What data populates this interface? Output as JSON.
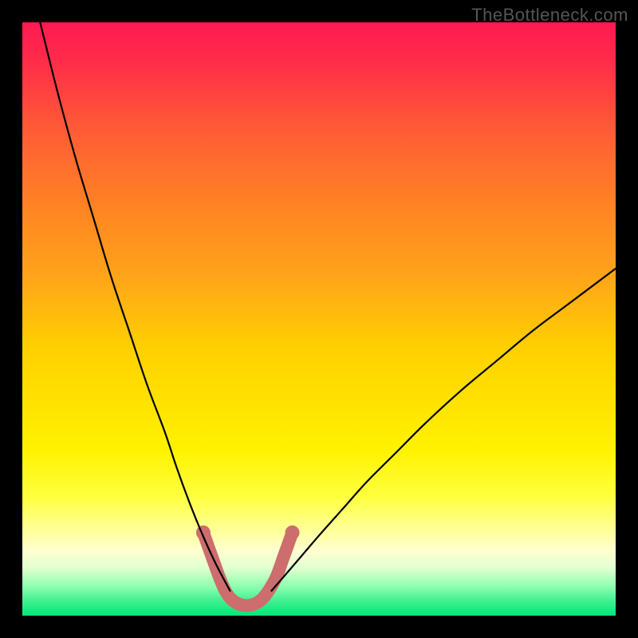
{
  "attribution": "TheBottleneck.com",
  "chart_data": {
    "type": "line",
    "title": "",
    "xlabel": "",
    "ylabel": "",
    "xlim": [
      0,
      100
    ],
    "ylim": [
      0,
      100
    ],
    "background_gradient": {
      "stops": [
        {
          "offset": 0.0,
          "color": "#ff1a52"
        },
        {
          "offset": 0.06,
          "color": "#ff2a4a"
        },
        {
          "offset": 0.18,
          "color": "#ff5b36"
        },
        {
          "offset": 0.3,
          "color": "#ff8024"
        },
        {
          "offset": 0.42,
          "color": "#ffa21a"
        },
        {
          "offset": 0.55,
          "color": "#ffd000"
        },
        {
          "offset": 0.72,
          "color": "#fff200"
        },
        {
          "offset": 0.8,
          "color": "#ffff40"
        },
        {
          "offset": 0.85,
          "color": "#ffff90"
        },
        {
          "offset": 0.89,
          "color": "#ffffd0"
        },
        {
          "offset": 0.92,
          "color": "#e0ffd0"
        },
        {
          "offset": 0.95,
          "color": "#90ffb0"
        },
        {
          "offset": 0.975,
          "color": "#40f090"
        },
        {
          "offset": 1.0,
          "color": "#00e878"
        }
      ]
    },
    "series": [
      {
        "name": "left-curve",
        "x": [
          3,
          6,
          9,
          12,
          15,
          18,
          21,
          24,
          26,
          28,
          30,
          32,
          33.5,
          35
        ],
        "y": [
          100,
          88,
          77,
          67,
          57,
          48,
          39,
          31,
          25,
          19.5,
          14.5,
          10,
          7,
          4.2
        ]
      },
      {
        "name": "right-curve",
        "x": [
          42,
          44,
          47,
          50,
          54,
          58,
          63,
          68,
          74,
          80,
          86,
          92,
          98,
          100
        ],
        "y": [
          4.2,
          6.5,
          10,
          13.5,
          18,
          22.5,
          27.5,
          32.5,
          38,
          43,
          48,
          52.5,
          57,
          58.5
        ]
      }
    ],
    "valley_segment": {
      "color": "#cd6d6d",
      "width": 16,
      "points": [
        {
          "x": 30.5,
          "y": 14.0
        },
        {
          "x": 32.0,
          "y": 9.8
        },
        {
          "x": 33.2,
          "y": 6.5
        },
        {
          "x": 34.2,
          "y": 4.2
        },
        {
          "x": 35.2,
          "y": 2.8
        },
        {
          "x": 36.4,
          "y": 2.0
        },
        {
          "x": 37.8,
          "y": 1.7
        },
        {
          "x": 39.2,
          "y": 2.0
        },
        {
          "x": 40.4,
          "y": 2.8
        },
        {
          "x": 41.5,
          "y": 4.2
        },
        {
          "x": 42.8,
          "y": 6.5
        },
        {
          "x": 44.0,
          "y": 9.8
        },
        {
          "x": 45.5,
          "y": 14.0
        }
      ],
      "dots": [
        {
          "x": 30.5,
          "y": 14.0,
          "r": 9
        },
        {
          "x": 32.0,
          "y": 9.8,
          "r": 8
        },
        {
          "x": 42.8,
          "y": 6.5,
          "r": 8
        },
        {
          "x": 44.0,
          "y": 9.8,
          "r": 8
        },
        {
          "x": 45.5,
          "y": 14.0,
          "r": 9
        }
      ]
    }
  }
}
